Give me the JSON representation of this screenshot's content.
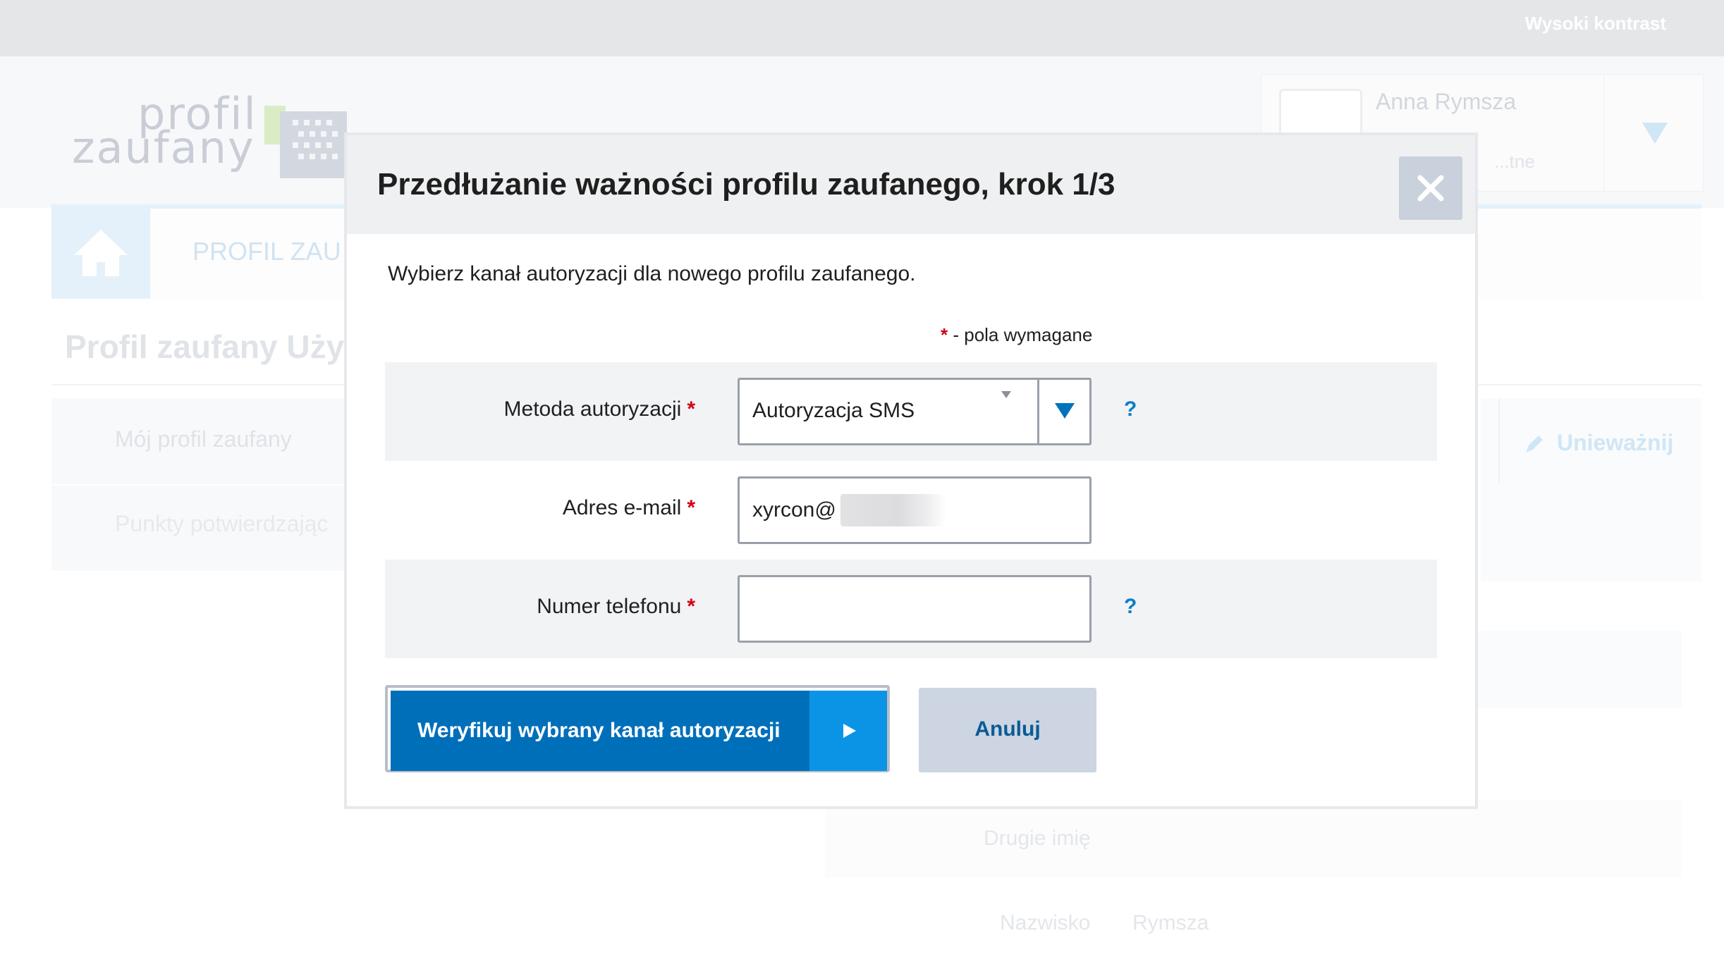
{
  "topbar": {
    "contrast_label": "Wysoki kontrast"
  },
  "logo": {
    "word1": "profil",
    "word2": "zaufany"
  },
  "user": {
    "name": "Anna Rymsza",
    "subtitle": "...tne"
  },
  "nav": {
    "label": "PROFIL ZAU"
  },
  "page": {
    "title": "Profil zaufany Uży",
    "sidebar": [
      "Mój profil zaufany",
      "Punkty potwierdzając"
    ],
    "invalidate_label": "Unieważnij",
    "ghost_fields": {
      "second_name_label": "Drugie imię",
      "surname_label": "Nazwisko",
      "surname_value": "Rymsza"
    }
  },
  "modal": {
    "title": "Przedłużanie ważności profilu zaufanego, krok 1/3",
    "intro": "Wybierz kanał autoryzacji dla nowego profilu zaufanego.",
    "required_star": "*",
    "required_note": " - pola wymagane",
    "fields": {
      "method": {
        "label": "Metoda autoryzacji",
        "value": "Autoryzacja SMS",
        "help": "?"
      },
      "email": {
        "label": "Adres e-mail",
        "value": "xyrcon@"
      },
      "phone": {
        "label": "Numer telefonu",
        "value": "",
        "placeholder": "",
        "help": "?"
      }
    },
    "buttons": {
      "verify": "Weryfikuj wybrany kanał autoryzacji",
      "cancel": "Anuluj"
    }
  },
  "colors": {
    "primary": "#006fb9",
    "primary_light": "#0b94e6",
    "required": "#d4001a",
    "help": "#0a7ec6",
    "cancel_bg": "#ccd5e1"
  }
}
